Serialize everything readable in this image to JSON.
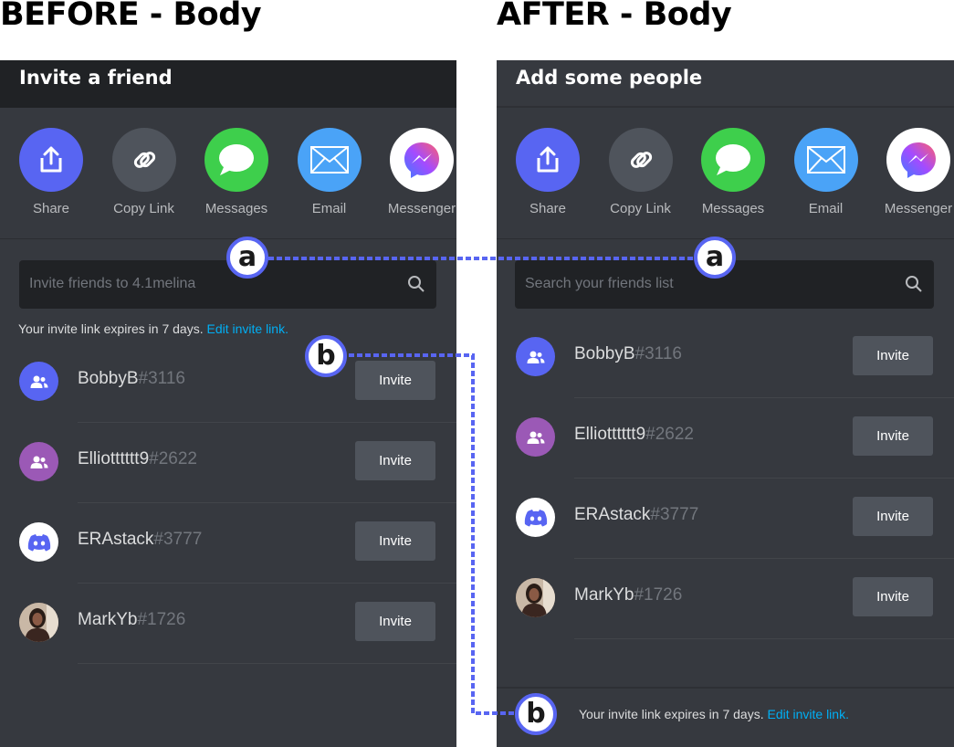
{
  "headings": {
    "before": "BEFORE - Body",
    "after": "AFTER - Body"
  },
  "before": {
    "title": "Invite a friend",
    "search_placeholder": "Invite  friends  to  4.1melina",
    "expire_text": "Your invite link expires in 7 days.",
    "expire_link": "Edit invite link."
  },
  "after": {
    "title": "Add some people",
    "search_placeholder": "Search your friends list",
    "expire_text": "Your invite link expires in 7 days.",
    "expire_link": "Edit invite link."
  },
  "share_options": [
    {
      "label": "Share",
      "icon": "share-icon",
      "color": "#5865f2"
    },
    {
      "label": "Copy Link",
      "icon": "link-icon",
      "color": "#4f545c"
    },
    {
      "label": "Messages",
      "icon": "message-bubble-icon",
      "color": "#3ecf4c"
    },
    {
      "label": "Email",
      "icon": "envelope-icon",
      "color": "#4aa3f7"
    },
    {
      "label": "Messenger",
      "icon": "messenger-icon",
      "color": "#ffffff"
    }
  ],
  "friends": [
    {
      "name": "BobbyB",
      "discriminator": "#3116",
      "avatar": "friends-icon",
      "avatar_color": "#5865f2"
    },
    {
      "name": "Elliotttttt9",
      "discriminator": "#2622",
      "avatar": "friends-icon",
      "avatar_color": "#9b59b6"
    },
    {
      "name": "ERAstack",
      "discriminator": "#3777",
      "avatar": "discord-logo-icon",
      "avatar_color": "#ffffff"
    },
    {
      "name": "MarkYb",
      "discriminator": "#1726",
      "avatar": "user-photo",
      "avatar_color": "#8a6a55"
    }
  ],
  "invite_label": "Invite",
  "markers": {
    "a": "a",
    "b": "b"
  },
  "colors": {
    "accent": "#5865f2",
    "link": "#00aff4",
    "panel": "#36393f",
    "dark": "#202225"
  }
}
